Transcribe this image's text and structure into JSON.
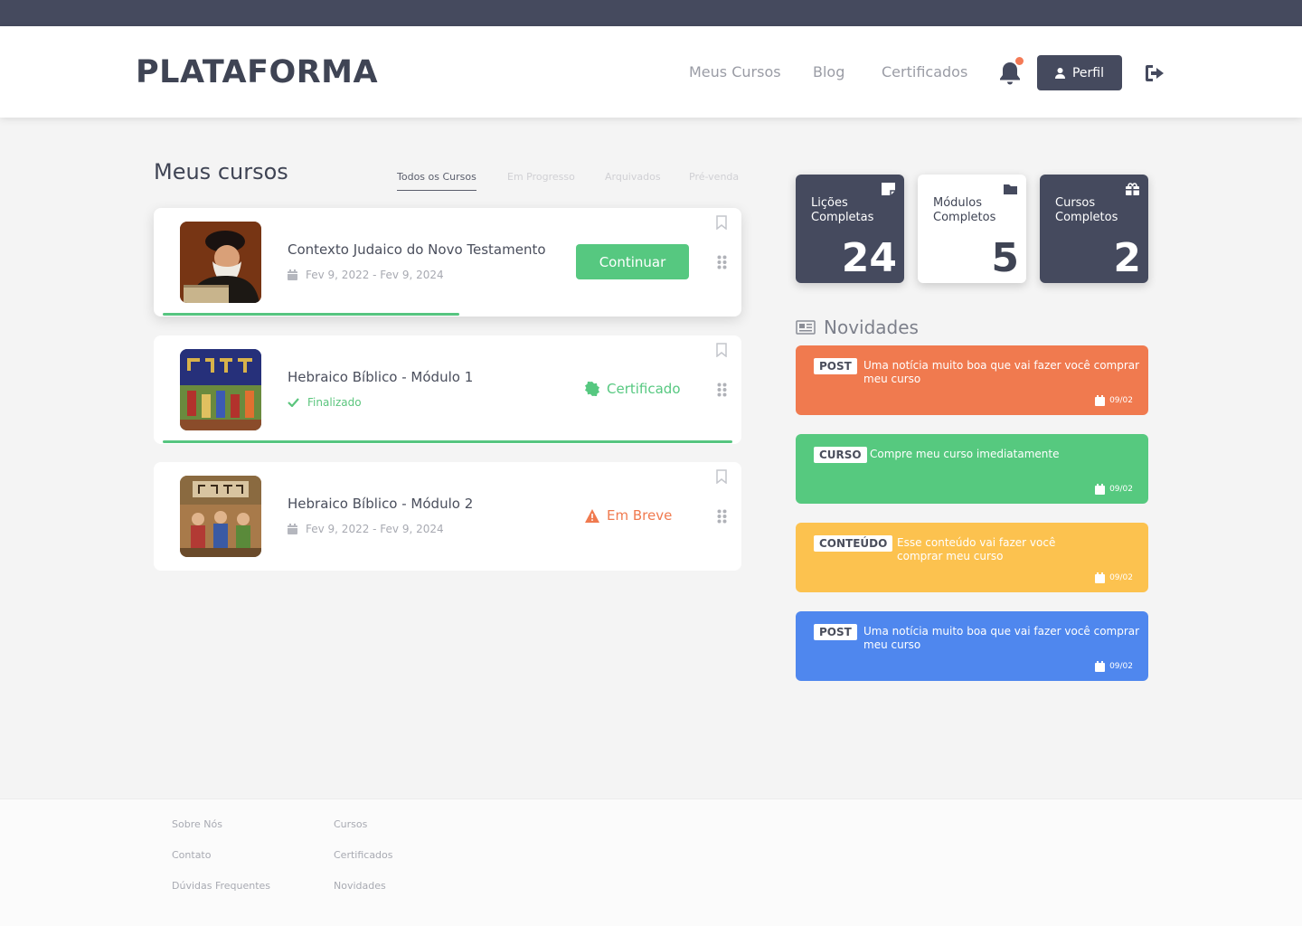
{
  "header": {
    "logo": "PLATAFORMA",
    "nav": [
      "Meus Cursos",
      "Blog",
      "Certificados"
    ],
    "profile_label": "Perfil"
  },
  "main": {
    "title": "Meus cursos",
    "tabs": [
      "Todos os Cursos",
      "Em Progresso",
      "Arquivados",
      "Pré-venda"
    ],
    "courses": [
      {
        "title": "Contexto Judaico do Novo Testamento",
        "meta": "Fev 9, 2022 - Fev 9, 2024",
        "action": "Continuar",
        "progress": 0.52
      },
      {
        "title": "Hebraico Bíblico - Módulo 1",
        "meta": "Finalizado",
        "status": "Certificado",
        "progress": 1.0
      },
      {
        "title": "Hebraico Bíblico - Módulo 2",
        "meta": "Fev 9, 2022 - Fev 9, 2024",
        "status": "Em Breve"
      }
    ]
  },
  "stats": [
    {
      "label": "Lições Completas",
      "value": "24"
    },
    {
      "label": "Módulos Completos",
      "value": "5"
    },
    {
      "label": "Cursos Completos",
      "value": "2"
    }
  ],
  "news": {
    "title": "Novidades",
    "items": [
      {
        "badge": "POST",
        "text": "Uma notícia muito boa que vai fazer você comprar meu curso",
        "date": "09/02",
        "color": "#f07a4f"
      },
      {
        "badge": "CURSO",
        "text": "Compre meu curso imediatamente",
        "date": "09/02",
        "color": "#56c97f"
      },
      {
        "badge": "CONTEÚDO",
        "text": "Esse conteúdo vai fazer você comprar meu curso",
        "date": "09/02",
        "color": "#fcc24f"
      },
      {
        "badge": "POST",
        "text": "Uma notícia muito boa que vai fazer você comprar meu curso",
        "date": "09/02",
        "color": "#4f87ee"
      }
    ]
  },
  "footer": {
    "col1": [
      "Sobre Nós",
      "Contato",
      "Dúvidas Frequentes"
    ],
    "col2": [
      "Cursos",
      "Certificados",
      "Novidades"
    ]
  },
  "colors": {
    "primary": "#454a5e",
    "accent": "#56c880",
    "warning": "#f07a4f"
  }
}
